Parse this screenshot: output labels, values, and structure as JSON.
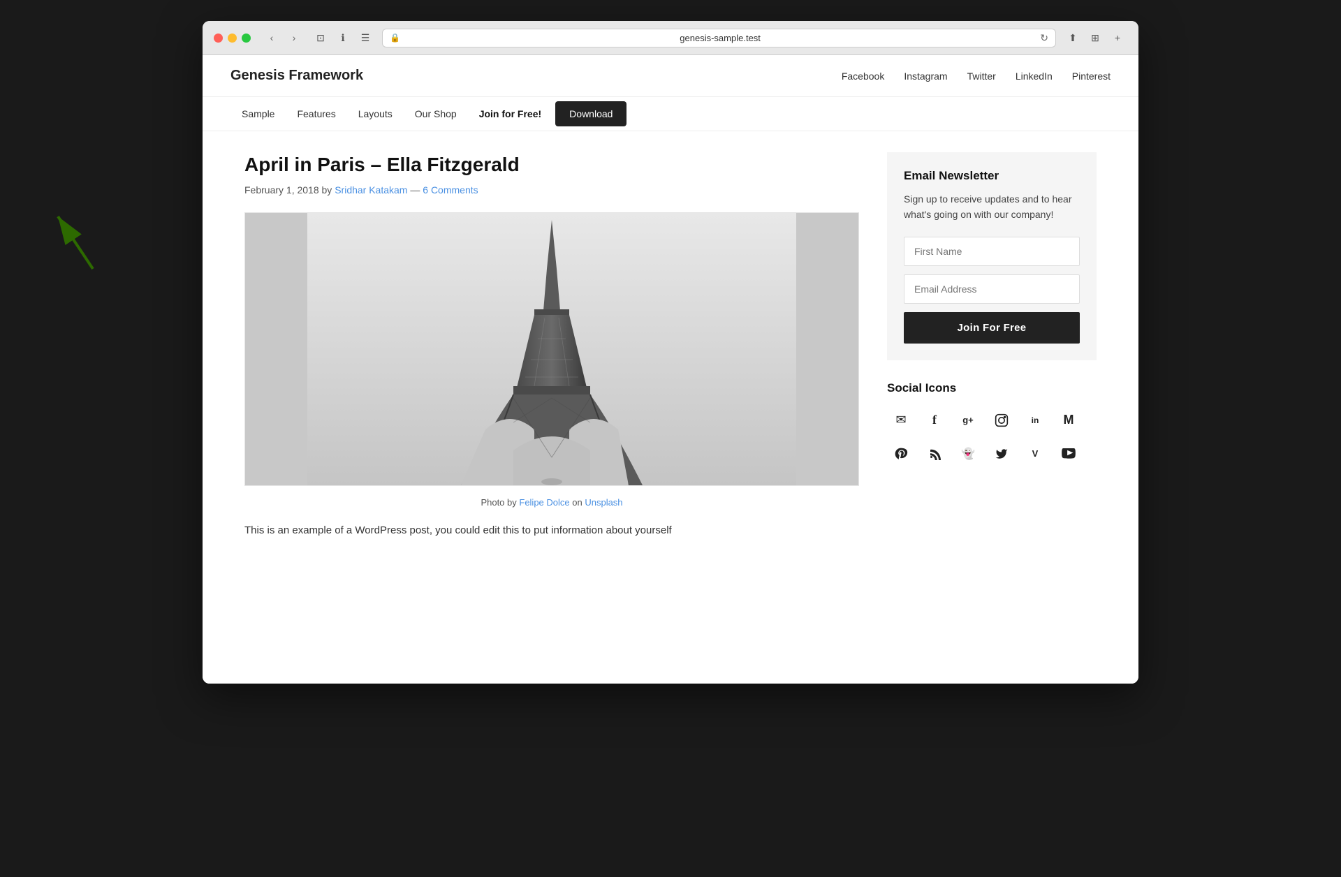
{
  "browser": {
    "address": "genesis-sample.test",
    "back_label": "‹",
    "forward_label": "›",
    "refresh_label": "↻",
    "tab_icon": "⊞",
    "share_label": "⬆",
    "new_tab_label": "+"
  },
  "site": {
    "title": "Genesis Framework",
    "header_nav": [
      {
        "label": "Facebook",
        "href": "#"
      },
      {
        "label": "Instagram",
        "href": "#"
      },
      {
        "label": "Twitter",
        "href": "#"
      },
      {
        "label": "LinkedIn",
        "href": "#"
      },
      {
        "label": "Pinterest",
        "href": "#"
      }
    ],
    "primary_nav": [
      {
        "label": "Sample",
        "href": "#",
        "style": "normal"
      },
      {
        "label": "Features",
        "href": "#",
        "style": "normal"
      },
      {
        "label": "Layouts",
        "href": "#",
        "style": "normal"
      },
      {
        "label": "Our Shop",
        "href": "#",
        "style": "normal"
      },
      {
        "label": "Join for Free!",
        "href": "#",
        "style": "bold"
      },
      {
        "label": "Download",
        "href": "#",
        "style": "download"
      }
    ]
  },
  "post": {
    "title": "April in Paris – Ella Fitzgerald",
    "date": "February 1, 2018",
    "author_label": "by",
    "author": "Sridhar Katakam",
    "separator": "—",
    "comments": "6 Comments",
    "photo_caption_prefix": "Photo by",
    "photographer": "Felipe Dolce",
    "on": "on",
    "photo_source": "Unsplash",
    "excerpt": "This is an example of a WordPress post, you could edit this to put information about yourself"
  },
  "sidebar": {
    "newsletter": {
      "title": "Email Newsletter",
      "description": "Sign up to receive updates and to hear what's going on with our company!",
      "first_name_placeholder": "First Name",
      "email_placeholder": "Email Address",
      "button_label": "Join For Free"
    },
    "social": {
      "title": "Social Icons",
      "icons": [
        {
          "name": "email-icon",
          "symbol": "✉"
        },
        {
          "name": "facebook-icon",
          "symbol": "f"
        },
        {
          "name": "google-plus-icon",
          "symbol": "g+"
        },
        {
          "name": "instagram-icon",
          "symbol": "◻"
        },
        {
          "name": "linkedin-icon",
          "symbol": "in"
        },
        {
          "name": "medium-icon",
          "symbol": "M"
        },
        {
          "name": "pinterest-icon",
          "symbol": "P"
        },
        {
          "name": "rss-icon",
          "symbol": "⌘"
        },
        {
          "name": "snapchat-icon",
          "symbol": "👻"
        },
        {
          "name": "twitter-icon",
          "symbol": "🐦"
        },
        {
          "name": "vimeo-icon",
          "symbol": "V"
        },
        {
          "name": "youtube-icon",
          "symbol": "▶"
        }
      ]
    }
  }
}
